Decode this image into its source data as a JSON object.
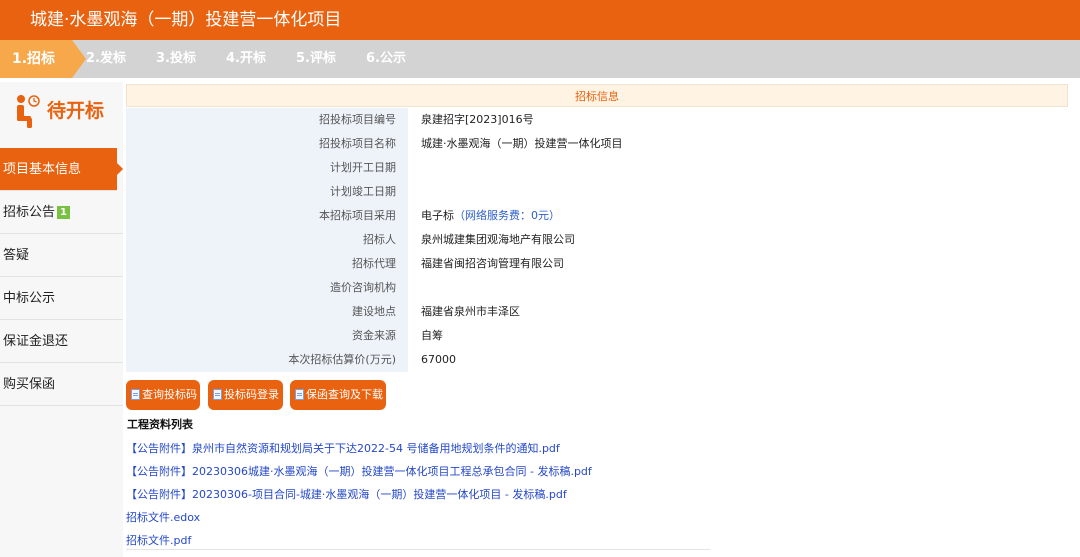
{
  "header": {
    "title": "城建·水墨观海（一期）投建营一体化项目"
  },
  "steps": [
    "1.招标",
    "2.发标",
    "3.投标",
    "4.开标",
    "5.评标",
    "6.公示"
  ],
  "sidebar": {
    "status": "待开标",
    "items": [
      {
        "label": "项目基本信息"
      },
      {
        "label": "招标公告",
        "badge": "1"
      },
      {
        "label": "答疑"
      },
      {
        "label": "中标公示"
      },
      {
        "label": "保证金退还"
      },
      {
        "label": "购买保函"
      }
    ]
  },
  "info": {
    "title": "招标信息",
    "rows": [
      {
        "label": "招投标项目编号",
        "value": "泉建招字[2023]016号"
      },
      {
        "label": "招投标项目名称",
        "value": "城建·水墨观海（一期）投建营一体化项目"
      },
      {
        "label": "计划开工日期",
        "value": ""
      },
      {
        "label": "计划竣工日期",
        "value": ""
      },
      {
        "label": "本招标项目采用",
        "value": "电子标",
        "note": "（网络服务费：0元）"
      },
      {
        "label": "招标人",
        "value": "泉州城建集团观海地产有限公司"
      },
      {
        "label": "招标代理",
        "value": "福建省闽招咨询管理有限公司"
      },
      {
        "label": "造价咨询机构",
        "value": ""
      },
      {
        "label": "建设地点",
        "value": "福建省泉州市丰泽区"
      },
      {
        "label": "资金来源",
        "value": "自筹"
      },
      {
        "label": "本次招标估算价(万元)",
        "value": "67000"
      }
    ]
  },
  "buttons": [
    "查询投标码",
    "投标码登录",
    "保函查询及下载"
  ],
  "files": {
    "title": "工程资料列表",
    "items": [
      "【公告附件】泉州市自然资源和规划局关于下达2022-54 号储备用地规划条件的通知.pdf",
      "【公告附件】20230306城建·水墨观海（一期）投建营一体化项目工程总承包合同 - 发标稿.pdf",
      "【公告附件】20230306-项目合同-城建·水墨观海（一期）投建营一体化项目 - 发标稿.pdf",
      "招标文件.edox",
      "招标文件.pdf"
    ]
  },
  "colors": {
    "accent": "#e8620f",
    "step_active": "#f6a84b",
    "link": "#2448c9",
    "badge": "#79c141"
  }
}
